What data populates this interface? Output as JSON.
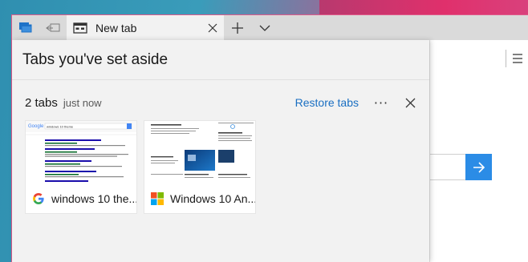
{
  "browser": {
    "tabs": [
      {
        "title": "New tab"
      }
    ]
  },
  "panel": {
    "title": "Tabs you've set aside",
    "group": {
      "count_label": "2 tabs",
      "time_label": "just now",
      "restore_label": "Restore tabs",
      "more_label": "···"
    },
    "saved_tabs": [
      {
        "title": "windows 10 the...",
        "favicon": "google-icon",
        "preview_search_text": "windows 10 theme"
      },
      {
        "title": "Windows 10 An...",
        "favicon": "windows-logo-icon"
      }
    ]
  },
  "colors": {
    "accent": "#2b8ce6",
    "link": "#1a6fc2",
    "panel_bg": "#f2f2f2",
    "tabbar_bg": "#dadada"
  }
}
